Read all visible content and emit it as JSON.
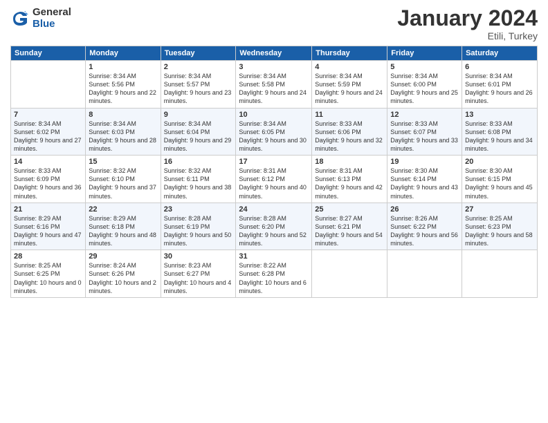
{
  "logo": {
    "general": "General",
    "blue": "Blue"
  },
  "title": {
    "month": "January 2024",
    "location": "Etili, Turkey"
  },
  "header": {
    "days": [
      "Sunday",
      "Monday",
      "Tuesday",
      "Wednesday",
      "Thursday",
      "Friday",
      "Saturday"
    ]
  },
  "weeks": [
    [
      {
        "day": "",
        "sunrise": "",
        "sunset": "",
        "daylight": ""
      },
      {
        "day": "1",
        "sunrise": "Sunrise: 8:34 AM",
        "sunset": "Sunset: 5:56 PM",
        "daylight": "Daylight: 9 hours and 22 minutes."
      },
      {
        "day": "2",
        "sunrise": "Sunrise: 8:34 AM",
        "sunset": "Sunset: 5:57 PM",
        "daylight": "Daylight: 9 hours and 23 minutes."
      },
      {
        "day": "3",
        "sunrise": "Sunrise: 8:34 AM",
        "sunset": "Sunset: 5:58 PM",
        "daylight": "Daylight: 9 hours and 24 minutes."
      },
      {
        "day": "4",
        "sunrise": "Sunrise: 8:34 AM",
        "sunset": "Sunset: 5:59 PM",
        "daylight": "Daylight: 9 hours and 24 minutes."
      },
      {
        "day": "5",
        "sunrise": "Sunrise: 8:34 AM",
        "sunset": "Sunset: 6:00 PM",
        "daylight": "Daylight: 9 hours and 25 minutes."
      },
      {
        "day": "6",
        "sunrise": "Sunrise: 8:34 AM",
        "sunset": "Sunset: 6:01 PM",
        "daylight": "Daylight: 9 hours and 26 minutes."
      }
    ],
    [
      {
        "day": "7",
        "sunrise": "Sunrise: 8:34 AM",
        "sunset": "Sunset: 6:02 PM",
        "daylight": "Daylight: 9 hours and 27 minutes."
      },
      {
        "day": "8",
        "sunrise": "Sunrise: 8:34 AM",
        "sunset": "Sunset: 6:03 PM",
        "daylight": "Daylight: 9 hours and 28 minutes."
      },
      {
        "day": "9",
        "sunrise": "Sunrise: 8:34 AM",
        "sunset": "Sunset: 6:04 PM",
        "daylight": "Daylight: 9 hours and 29 minutes."
      },
      {
        "day": "10",
        "sunrise": "Sunrise: 8:34 AM",
        "sunset": "Sunset: 6:05 PM",
        "daylight": "Daylight: 9 hours and 30 minutes."
      },
      {
        "day": "11",
        "sunrise": "Sunrise: 8:33 AM",
        "sunset": "Sunset: 6:06 PM",
        "daylight": "Daylight: 9 hours and 32 minutes."
      },
      {
        "day": "12",
        "sunrise": "Sunrise: 8:33 AM",
        "sunset": "Sunset: 6:07 PM",
        "daylight": "Daylight: 9 hours and 33 minutes."
      },
      {
        "day": "13",
        "sunrise": "Sunrise: 8:33 AM",
        "sunset": "Sunset: 6:08 PM",
        "daylight": "Daylight: 9 hours and 34 minutes."
      }
    ],
    [
      {
        "day": "14",
        "sunrise": "Sunrise: 8:33 AM",
        "sunset": "Sunset: 6:09 PM",
        "daylight": "Daylight: 9 hours and 36 minutes."
      },
      {
        "day": "15",
        "sunrise": "Sunrise: 8:32 AM",
        "sunset": "Sunset: 6:10 PM",
        "daylight": "Daylight: 9 hours and 37 minutes."
      },
      {
        "day": "16",
        "sunrise": "Sunrise: 8:32 AM",
        "sunset": "Sunset: 6:11 PM",
        "daylight": "Daylight: 9 hours and 38 minutes."
      },
      {
        "day": "17",
        "sunrise": "Sunrise: 8:31 AM",
        "sunset": "Sunset: 6:12 PM",
        "daylight": "Daylight: 9 hours and 40 minutes."
      },
      {
        "day": "18",
        "sunrise": "Sunrise: 8:31 AM",
        "sunset": "Sunset: 6:13 PM",
        "daylight": "Daylight: 9 hours and 42 minutes."
      },
      {
        "day": "19",
        "sunrise": "Sunrise: 8:30 AM",
        "sunset": "Sunset: 6:14 PM",
        "daylight": "Daylight: 9 hours and 43 minutes."
      },
      {
        "day": "20",
        "sunrise": "Sunrise: 8:30 AM",
        "sunset": "Sunset: 6:15 PM",
        "daylight": "Daylight: 9 hours and 45 minutes."
      }
    ],
    [
      {
        "day": "21",
        "sunrise": "Sunrise: 8:29 AM",
        "sunset": "Sunset: 6:16 PM",
        "daylight": "Daylight: 9 hours and 47 minutes."
      },
      {
        "day": "22",
        "sunrise": "Sunrise: 8:29 AM",
        "sunset": "Sunset: 6:18 PM",
        "daylight": "Daylight: 9 hours and 48 minutes."
      },
      {
        "day": "23",
        "sunrise": "Sunrise: 8:28 AM",
        "sunset": "Sunset: 6:19 PM",
        "daylight": "Daylight: 9 hours and 50 minutes."
      },
      {
        "day": "24",
        "sunrise": "Sunrise: 8:28 AM",
        "sunset": "Sunset: 6:20 PM",
        "daylight": "Daylight: 9 hours and 52 minutes."
      },
      {
        "day": "25",
        "sunrise": "Sunrise: 8:27 AM",
        "sunset": "Sunset: 6:21 PM",
        "daylight": "Daylight: 9 hours and 54 minutes."
      },
      {
        "day": "26",
        "sunrise": "Sunrise: 8:26 AM",
        "sunset": "Sunset: 6:22 PM",
        "daylight": "Daylight: 9 hours and 56 minutes."
      },
      {
        "day": "27",
        "sunrise": "Sunrise: 8:25 AM",
        "sunset": "Sunset: 6:23 PM",
        "daylight": "Daylight: 9 hours and 58 minutes."
      }
    ],
    [
      {
        "day": "28",
        "sunrise": "Sunrise: 8:25 AM",
        "sunset": "Sunset: 6:25 PM",
        "daylight": "Daylight: 10 hours and 0 minutes."
      },
      {
        "day": "29",
        "sunrise": "Sunrise: 8:24 AM",
        "sunset": "Sunset: 6:26 PM",
        "daylight": "Daylight: 10 hours and 2 minutes."
      },
      {
        "day": "30",
        "sunrise": "Sunrise: 8:23 AM",
        "sunset": "Sunset: 6:27 PM",
        "daylight": "Daylight: 10 hours and 4 minutes."
      },
      {
        "day": "31",
        "sunrise": "Sunrise: 8:22 AM",
        "sunset": "Sunset: 6:28 PM",
        "daylight": "Daylight: 10 hours and 6 minutes."
      },
      {
        "day": "",
        "sunrise": "",
        "sunset": "",
        "daylight": ""
      },
      {
        "day": "",
        "sunrise": "",
        "sunset": "",
        "daylight": ""
      },
      {
        "day": "",
        "sunrise": "",
        "sunset": "",
        "daylight": ""
      }
    ]
  ]
}
